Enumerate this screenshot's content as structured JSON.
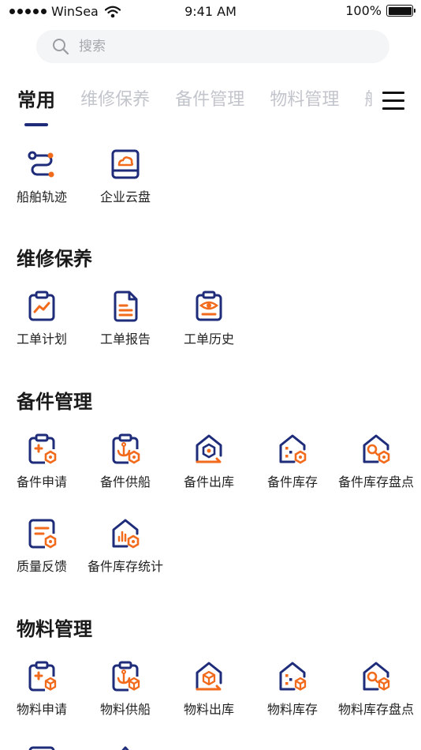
{
  "status": {
    "carrier": "WinSea",
    "time": "9:41 AM",
    "battery": "100%"
  },
  "search": {
    "placeholder": "搜索"
  },
  "tabs": [
    "常用",
    "维修保养",
    "备件管理",
    "物料管理",
    "航"
  ],
  "common": [
    {
      "label": "船舶轨迹",
      "icon": "route-icon"
    },
    {
      "label": "企业云盘",
      "icon": "cloud-drive-icon"
    }
  ],
  "maintenance": {
    "title": "维修保养",
    "items": [
      {
        "label": "工单计划",
        "icon": "plan-chart-icon"
      },
      {
        "label": "工单报告",
        "icon": "report-doc-icon"
      },
      {
        "label": "工单历史",
        "icon": "history-eye-icon"
      }
    ]
  },
  "spares": {
    "title": "备件管理",
    "items": [
      {
        "label": "备件申请",
        "icon": "spare-apply-icon"
      },
      {
        "label": "备件供船",
        "icon": "spare-supply-icon"
      },
      {
        "label": "备件出库",
        "icon": "spare-outbound-icon"
      },
      {
        "label": "备件库存",
        "icon": "spare-stock-icon"
      },
      {
        "label": "备件库存盘点",
        "icon": "spare-count-icon"
      },
      {
        "label": "质量反馈",
        "icon": "quality-feedback-icon"
      },
      {
        "label": "备件库存统计",
        "icon": "spare-statistics-icon"
      }
    ]
  },
  "materials": {
    "title": "物料管理",
    "items": [
      {
        "label": "物料申请",
        "icon": "material-apply-icon"
      },
      {
        "label": "物料供船",
        "icon": "material-supply-icon"
      },
      {
        "label": "物料出库",
        "icon": "material-outbound-icon"
      },
      {
        "label": "物料库存",
        "icon": "material-stock-icon"
      },
      {
        "label": "物料库存盘点",
        "icon": "material-count-icon"
      }
    ]
  },
  "colors": {
    "navy": "#1e2c7a",
    "orange": "#f26a1b"
  }
}
